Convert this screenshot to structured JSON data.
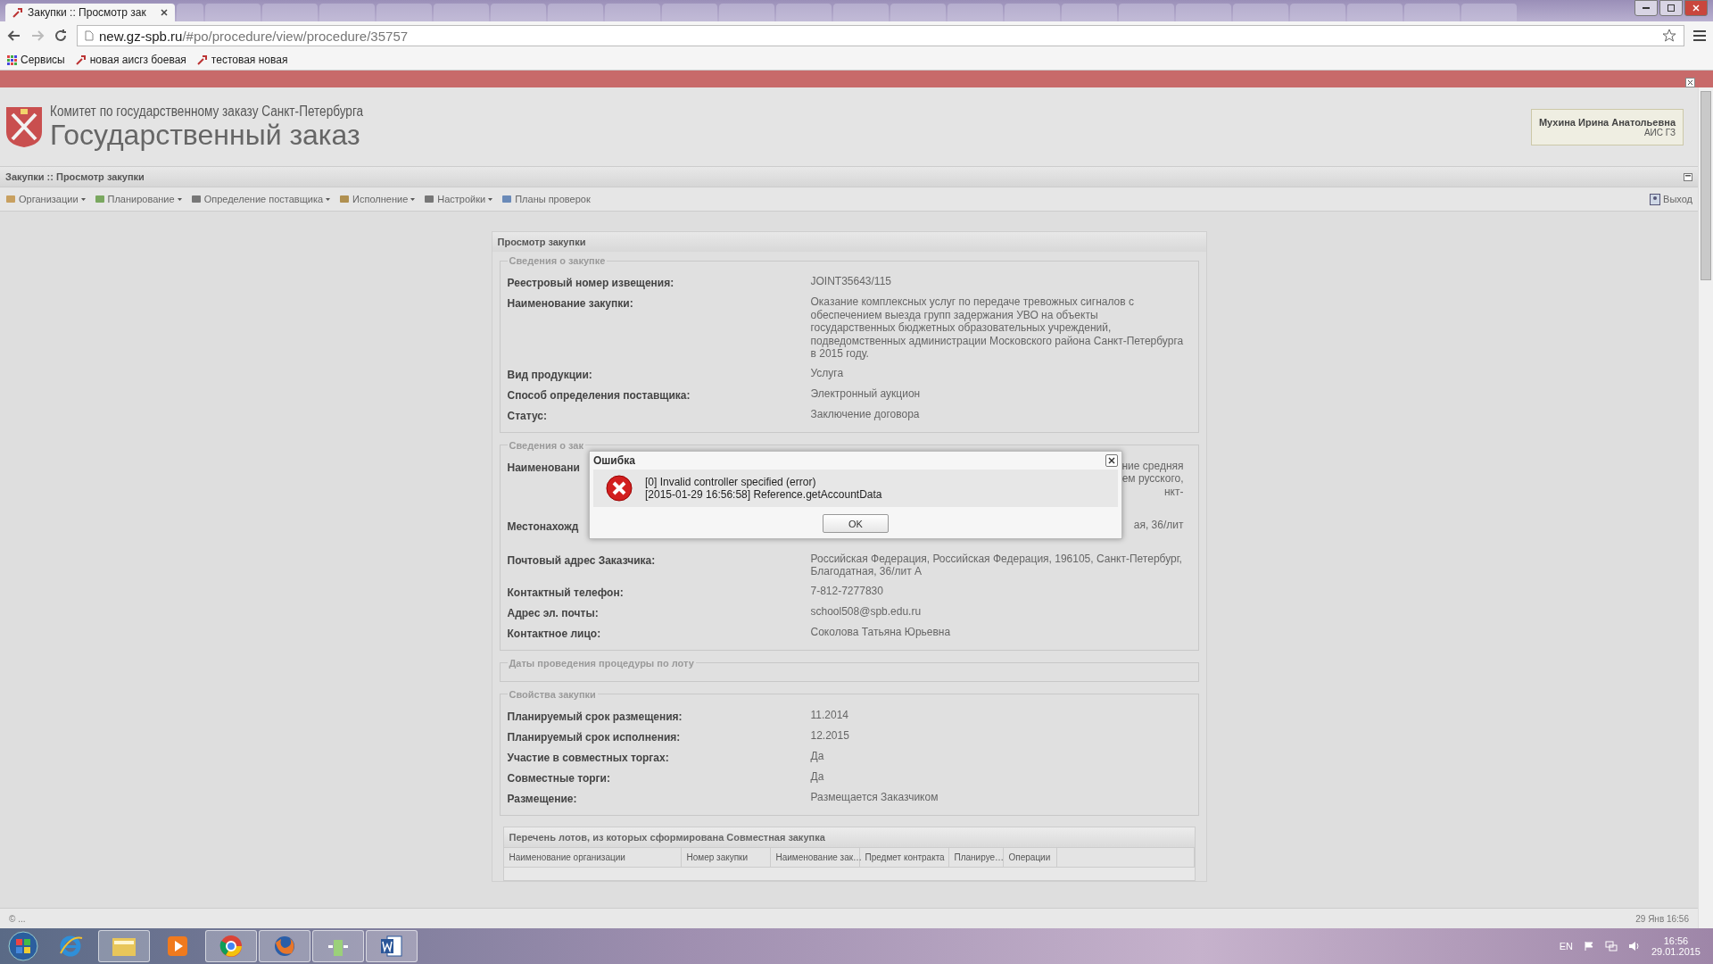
{
  "browser": {
    "tab": {
      "title": "Закупки :: Просмотр зак",
      "selected": true
    },
    "url_host": "new.gz-spb.ru",
    "url_path": "/#po/procedure/view/procedure/35757",
    "bookmarks": [
      {
        "kind": "apps",
        "label": "Сервисы"
      },
      {
        "kind": "page",
        "label": "новая аисгз боевая"
      },
      {
        "kind": "page",
        "label": "тестовая новая"
      }
    ]
  },
  "header": {
    "org": "Комитет по государственному заказу Санкт-Петербурга",
    "title": "Государственный заказ",
    "user": "Мухина Ирина Анатольевна",
    "role": "АИС ГЗ"
  },
  "breadcrumb": "Закупки :: Просмотр закупки",
  "menu": [
    {
      "label": "Организации",
      "dropdown": true
    },
    {
      "label": "Планирование",
      "dropdown": true
    },
    {
      "label": "Определение поставщика",
      "dropdown": true
    },
    {
      "label": "Исполнение",
      "dropdown": true
    },
    {
      "label": "Настройки",
      "dropdown": true
    },
    {
      "label": "Планы проверок",
      "dropdown": false
    }
  ],
  "logout": "Выход",
  "panel": {
    "title": "Просмотр закупки",
    "sections": [
      {
        "title": "Сведения о закупке",
        "rows": [
          {
            "label": "Реестровый номер извещения:",
            "value": "JOINT35643/115",
            "obscured": false
          },
          {
            "label": "Наименование закупки:",
            "value": "Оказание комплексных услуг по передаче тревожных сигналов с обеспечением выезда групп задержания УВО на объекты государственных бюджетных образовательных учреждений, подведомственных администрации Московского района Санкт-Петербурга в 2015 году.",
            "obscured": false
          },
          {
            "label": "Вид продукции:",
            "value": "Услуга",
            "obscured": false
          },
          {
            "label": "Способ определения поставщика:",
            "value": "Электронный аукцион",
            "obscured": false
          },
          {
            "label": "Статус:",
            "value": "Заключение договора",
            "obscured": false
          }
        ]
      },
      {
        "title": "Сведения о зак",
        "rows": [
          {
            "label": "Наименовани",
            "value_lines": [
              "ние средняя",
              "ем русского,",
              "нкт-"
            ],
            "obscured": true
          },
          {
            "label": "Местонахожд",
            "value_lines": [
              "ая, 36/лит"
            ],
            "obscured": true
          },
          {
            "label": "Почтовый адрес Заказчика:",
            "value": "Российская Федерация, Российская Федерация, 196105, Санкт-Петербург, Благодатная, 36/лит А",
            "obscured": false
          },
          {
            "label": "Контактный телефон:",
            "value": "7-812-7277830",
            "obscured": false
          },
          {
            "label": "Адрес эл. почты:",
            "value": "school508@spb.edu.ru",
            "obscured": false
          },
          {
            "label": "Контактное лицо:",
            "value": "Соколова Татьяна Юрьевна",
            "obscured": false
          }
        ]
      },
      {
        "title": "Даты проведения процедуры по лоту"
      },
      {
        "title": "Свойства закупки",
        "rows": [
          {
            "label": "Планируемый срок размещения:",
            "value": "11.2014",
            "obscured": false
          },
          {
            "label": "Планируемый срок исполнения:",
            "value": "12.2015",
            "obscured": false
          },
          {
            "label": "Участие в совместных торгах:",
            "value": "Да",
            "obscured": false
          },
          {
            "label": "Совместные торги:",
            "value": "Да",
            "obscured": false
          },
          {
            "label": "Размещение:",
            "value": "Размещается Заказчиком",
            "obscured": false
          }
        ]
      }
    ],
    "grid": {
      "title": "Перечень лотов, из которых сформирована Совместная закупка",
      "columns": [
        "Наименование организации",
        "Номер закупки",
        "Наименование зак…",
        "Предмет контракта",
        "Планируе…",
        "Операции"
      ]
    }
  },
  "dialog": {
    "title": "Ошибка",
    "lines": [
      "[0] Invalid controller specified (error)",
      "[2015-01-29 16:56:58] Reference.getAccountData"
    ],
    "button": "OK"
  },
  "status_bar": {
    "left": "© ...",
    "right": "29 Янв 16:56"
  },
  "taskbar": {
    "apps": [
      {
        "kind": "ie",
        "running": false
      },
      {
        "kind": "folder",
        "running": true
      },
      {
        "kind": "media",
        "running": false
      },
      {
        "kind": "chrome",
        "running": true
      },
      {
        "kind": "firefox",
        "running": true
      },
      {
        "kind": "app",
        "running": true
      },
      {
        "kind": "word",
        "running": true
      }
    ],
    "language": "EN",
    "time": "16:56",
    "date": "29.01.2015"
  }
}
